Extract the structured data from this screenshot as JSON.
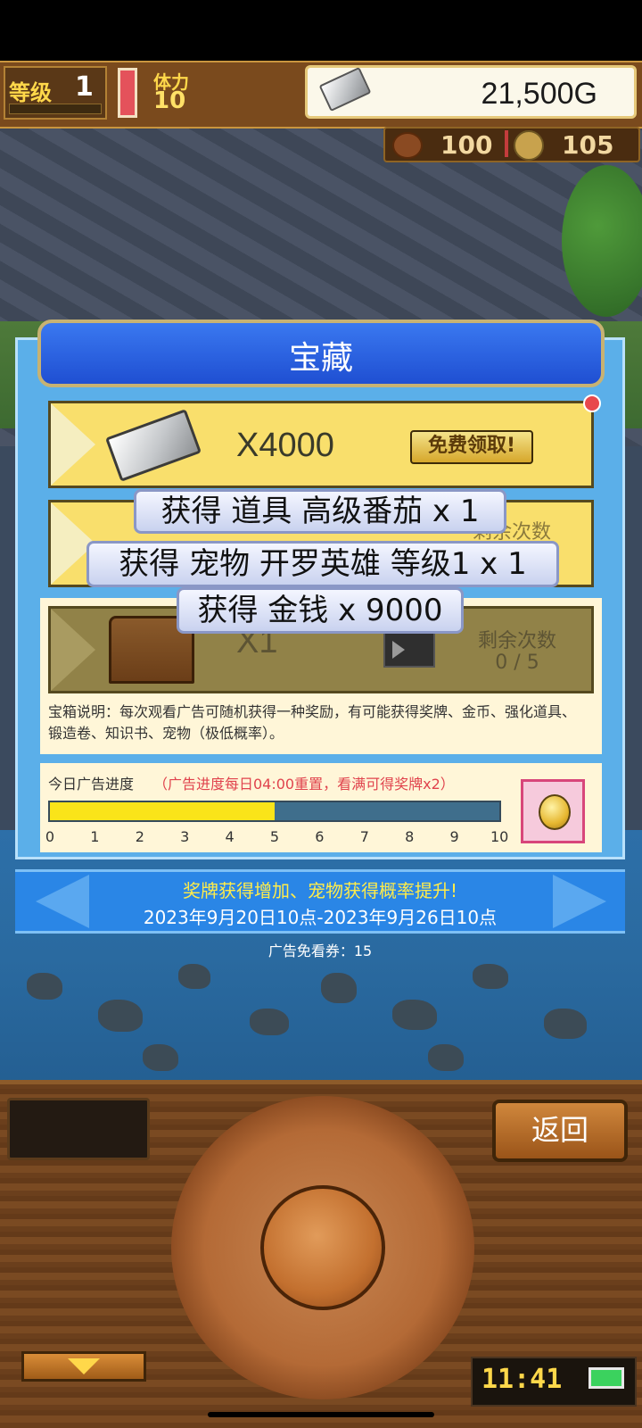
{
  "hud": {
    "level_label": "等级",
    "level_value": "1",
    "stamina_label": "体力",
    "stamina_value": "10",
    "gold_value": "21,500G",
    "meat_value": "100",
    "coin_value": "105"
  },
  "dialog": {
    "title": "宝藏",
    "rows": [
      {
        "qty": "X4000",
        "action": "免费领取!"
      },
      {
        "remain_label": "剩余次数"
      },
      {
        "qty": "X1",
        "remain_label": "剩余次数",
        "remain_value": "0 / 5"
      }
    ],
    "description": "宝箱说明：每次观看广告可随机获得一种奖励，有可能获得奖牌、金币、强化道具、锻造卷、知识书、宠物（极低概率）。",
    "progress": {
      "label": "今日广告进度",
      "note": "（广告进度每日04:00重置，看满可得奖牌x2）",
      "current": 5,
      "max": 10,
      "ticks": [
        "0",
        "1",
        "2",
        "3",
        "4",
        "5",
        "6",
        "7",
        "8",
        "9",
        "10"
      ]
    }
  },
  "banner": {
    "line1": "奖牌获得增加、宠物获得概率提升!",
    "line2": "2023年9月20日10点-2023年9月26日10点"
  },
  "voucher": "广告免看券：15",
  "toasts": [
    "获得 道具 高级番茄 x 1",
    "获得 宠物  开罗英雄 等级1 x 1",
    "获得 金钱 x 9000"
  ],
  "controls": {
    "back_label": "返回",
    "clock": "11:41"
  },
  "colors": {
    "title_blue": "#2a5fe0",
    "row_yellow": "#f9df6c",
    "progress_fill": "#fae419",
    "note_red": "#e0434d",
    "banner_yellow_text": "#ffec4a"
  }
}
